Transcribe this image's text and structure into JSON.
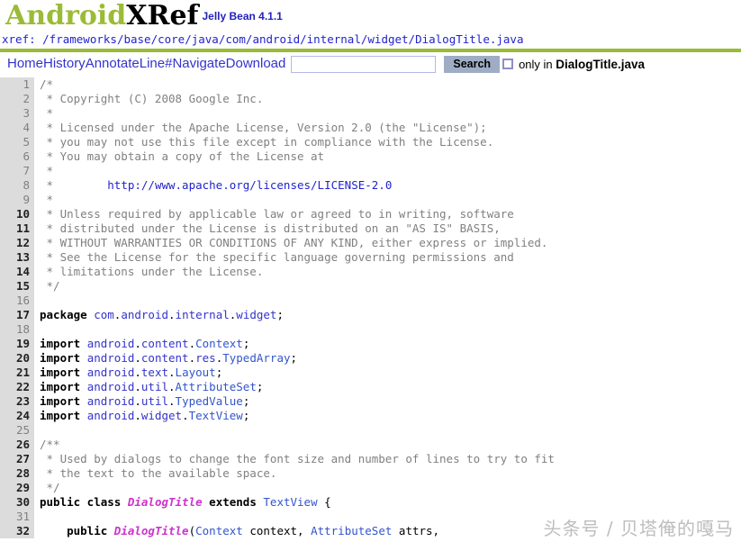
{
  "masthead": {
    "logo_part1": "Android",
    "logo_part2": "XRef",
    "version": "Jelly Bean 4.1.1",
    "logo_color_green": "#9bbb37",
    "logo_color_black": "#000000",
    "version_color": "#2222bb"
  },
  "xref": {
    "label": "xref: ",
    "path": "/frameworks/base/core/java/com/android/internal/widget/DialogTitle.java",
    "rule_color": "#9bbb37"
  },
  "menu": {
    "links": [
      {
        "label": "Home",
        "name": "nav-home"
      },
      {
        "label": "History",
        "name": "nav-history"
      },
      {
        "label": "Annotate",
        "name": "nav-annotate"
      },
      {
        "label": "Line#",
        "name": "nav-line-number"
      },
      {
        "label": "Navigate",
        "name": "nav-navigate"
      },
      {
        "label": "Download",
        "name": "nav-download"
      }
    ],
    "search_value": "",
    "search_placeholder": "",
    "search_button": "Search",
    "only_in_prefix": "only in ",
    "only_in_file": "DialogTitle.java",
    "checkbox_checked": false,
    "button_color": "#9eadc4",
    "link_color": "#3333cc"
  },
  "code": {
    "gutter_color": "#dcdcdc",
    "lineno_color": "#808080",
    "lines": [
      {
        "n": "1",
        "tokens": [
          {
            "t": "/*",
            "c": "c"
          }
        ]
      },
      {
        "n": "2",
        "tokens": [
          {
            "t": " * Copyright (C) 2008 Google Inc.",
            "c": "c"
          }
        ]
      },
      {
        "n": "3",
        "tokens": [
          {
            "t": " *",
            "c": "c"
          }
        ]
      },
      {
        "n": "4",
        "tokens": [
          {
            "t": " * Licensed under the Apache License, Version 2.0 (the \"License\");",
            "c": "c"
          }
        ]
      },
      {
        "n": "5",
        "tokens": [
          {
            "t": " * you may not use this file except in compliance with the License.",
            "c": "c"
          }
        ]
      },
      {
        "n": "6",
        "tokens": [
          {
            "t": " * You may obtain a copy of the License at",
            "c": "c"
          }
        ]
      },
      {
        "n": "7",
        "tokens": [
          {
            "t": " *",
            "c": "c"
          }
        ]
      },
      {
        "n": "8",
        "tokens": [
          {
            "t": " *        ",
            "c": "c"
          },
          {
            "t": "http://www.apache.org/licenses/LICENSE-2.0",
            "c": "a"
          }
        ]
      },
      {
        "n": "9",
        "tokens": [
          {
            "t": " *",
            "c": "c"
          }
        ]
      },
      {
        "n": "10",
        "hl": true,
        "tokens": [
          {
            "t": " * Unless required by applicable law or agreed to in writing, software",
            "c": "c"
          }
        ]
      },
      {
        "n": "11",
        "hl": true,
        "tokens": [
          {
            "t": " * distributed under the License is distributed on an \"AS IS\" BASIS,",
            "c": "c"
          }
        ]
      },
      {
        "n": "12",
        "hl": true,
        "tokens": [
          {
            "t": " * WITHOUT WARRANTIES OR CONDITIONS OF ANY KIND, either express or implied.",
            "c": "c"
          }
        ]
      },
      {
        "n": "13",
        "hl": true,
        "tokens": [
          {
            "t": " * See the License for the specific language governing permissions and",
            "c": "c"
          }
        ]
      },
      {
        "n": "14",
        "hl": true,
        "tokens": [
          {
            "t": " * limitations under the License.",
            "c": "c"
          }
        ]
      },
      {
        "n": "15",
        "hl": true,
        "tokens": [
          {
            "t": " */",
            "c": "c"
          }
        ]
      },
      {
        "n": "16",
        "tokens": []
      },
      {
        "n": "17",
        "hl": true,
        "tokens": [
          {
            "t": "package",
            "c": "k"
          },
          {
            "t": " ",
            "c": "p"
          },
          {
            "t": "com",
            "c": "n"
          },
          {
            "t": ".",
            "c": "p"
          },
          {
            "t": "android",
            "c": "n"
          },
          {
            "t": ".",
            "c": "p"
          },
          {
            "t": "internal",
            "c": "n"
          },
          {
            "t": ".",
            "c": "p"
          },
          {
            "t": "widget",
            "c": "n"
          },
          {
            "t": ";",
            "c": "p"
          }
        ]
      },
      {
        "n": "18",
        "tokens": []
      },
      {
        "n": "19",
        "hl": true,
        "tokens": [
          {
            "t": "import",
            "c": "k"
          },
          {
            "t": " ",
            "c": "p"
          },
          {
            "t": "android",
            "c": "n"
          },
          {
            "t": ".",
            "c": "p"
          },
          {
            "t": "content",
            "c": "n"
          },
          {
            "t": ".",
            "c": "p"
          },
          {
            "t": "Context",
            "c": "t"
          },
          {
            "t": ";",
            "c": "p"
          }
        ]
      },
      {
        "n": "20",
        "hl": true,
        "tokens": [
          {
            "t": "import",
            "c": "k"
          },
          {
            "t": " ",
            "c": "p"
          },
          {
            "t": "android",
            "c": "n"
          },
          {
            "t": ".",
            "c": "p"
          },
          {
            "t": "content",
            "c": "n"
          },
          {
            "t": ".",
            "c": "p"
          },
          {
            "t": "res",
            "c": "n"
          },
          {
            "t": ".",
            "c": "p"
          },
          {
            "t": "TypedArray",
            "c": "t"
          },
          {
            "t": ";",
            "c": "p"
          }
        ]
      },
      {
        "n": "21",
        "hl": true,
        "tokens": [
          {
            "t": "import",
            "c": "k"
          },
          {
            "t": " ",
            "c": "p"
          },
          {
            "t": "android",
            "c": "n"
          },
          {
            "t": ".",
            "c": "p"
          },
          {
            "t": "text",
            "c": "n"
          },
          {
            "t": ".",
            "c": "p"
          },
          {
            "t": "Layout",
            "c": "t"
          },
          {
            "t": ";",
            "c": "p"
          }
        ]
      },
      {
        "n": "22",
        "hl": true,
        "tokens": [
          {
            "t": "import",
            "c": "k"
          },
          {
            "t": " ",
            "c": "p"
          },
          {
            "t": "android",
            "c": "n"
          },
          {
            "t": ".",
            "c": "p"
          },
          {
            "t": "util",
            "c": "n"
          },
          {
            "t": ".",
            "c": "p"
          },
          {
            "t": "AttributeSet",
            "c": "t"
          },
          {
            "t": ";",
            "c": "p"
          }
        ]
      },
      {
        "n": "23",
        "hl": true,
        "tokens": [
          {
            "t": "import",
            "c": "k"
          },
          {
            "t": " ",
            "c": "p"
          },
          {
            "t": "android",
            "c": "n"
          },
          {
            "t": ".",
            "c": "p"
          },
          {
            "t": "util",
            "c": "n"
          },
          {
            "t": ".",
            "c": "p"
          },
          {
            "t": "TypedValue",
            "c": "t"
          },
          {
            "t": ";",
            "c": "p"
          }
        ]
      },
      {
        "n": "24",
        "hl": true,
        "tokens": [
          {
            "t": "import",
            "c": "k"
          },
          {
            "t": " ",
            "c": "p"
          },
          {
            "t": "android",
            "c": "n"
          },
          {
            "t": ".",
            "c": "p"
          },
          {
            "t": "widget",
            "c": "n"
          },
          {
            "t": ".",
            "c": "p"
          },
          {
            "t": "TextView",
            "c": "t"
          },
          {
            "t": ";",
            "c": "p"
          }
        ]
      },
      {
        "n": "25",
        "tokens": []
      },
      {
        "n": "26",
        "hl": true,
        "tokens": [
          {
            "t": "/**",
            "c": "c"
          }
        ]
      },
      {
        "n": "27",
        "hl": true,
        "tokens": [
          {
            "t": " * Used by dialogs to change the font size and number of lines to try to fit",
            "c": "c"
          }
        ]
      },
      {
        "n": "28",
        "hl": true,
        "tokens": [
          {
            "t": " * the text to the available space.",
            "c": "c"
          }
        ]
      },
      {
        "n": "29",
        "hl": true,
        "tokens": [
          {
            "t": " */",
            "c": "c"
          }
        ]
      },
      {
        "n": "30",
        "hl": true,
        "tokens": [
          {
            "t": "public class",
            "c": "k"
          },
          {
            "t": " ",
            "c": "p"
          },
          {
            "t": "DialogTitle",
            "c": "d"
          },
          {
            "t": " ",
            "c": "p"
          },
          {
            "t": "extends",
            "c": "k"
          },
          {
            "t": " ",
            "c": "p"
          },
          {
            "t": "TextView",
            "c": "t"
          },
          {
            "t": " {",
            "c": "p"
          }
        ]
      },
      {
        "n": "31",
        "tokens": []
      },
      {
        "n": "32",
        "hl": true,
        "tokens": [
          {
            "t": "    ",
            "c": "p"
          },
          {
            "t": "public",
            "c": "k"
          },
          {
            "t": " ",
            "c": "p"
          },
          {
            "t": "DialogTitle",
            "c": "d"
          },
          {
            "t": "(",
            "c": "p"
          },
          {
            "t": "Context",
            "c": "t"
          },
          {
            "t": " context, ",
            "c": "p"
          },
          {
            "t": "AttributeSet",
            "c": "t"
          },
          {
            "t": " attrs,",
            "c": "p"
          }
        ]
      }
    ]
  },
  "watermark": {
    "text": "头条号 / 贝塔俺的嘎马"
  }
}
